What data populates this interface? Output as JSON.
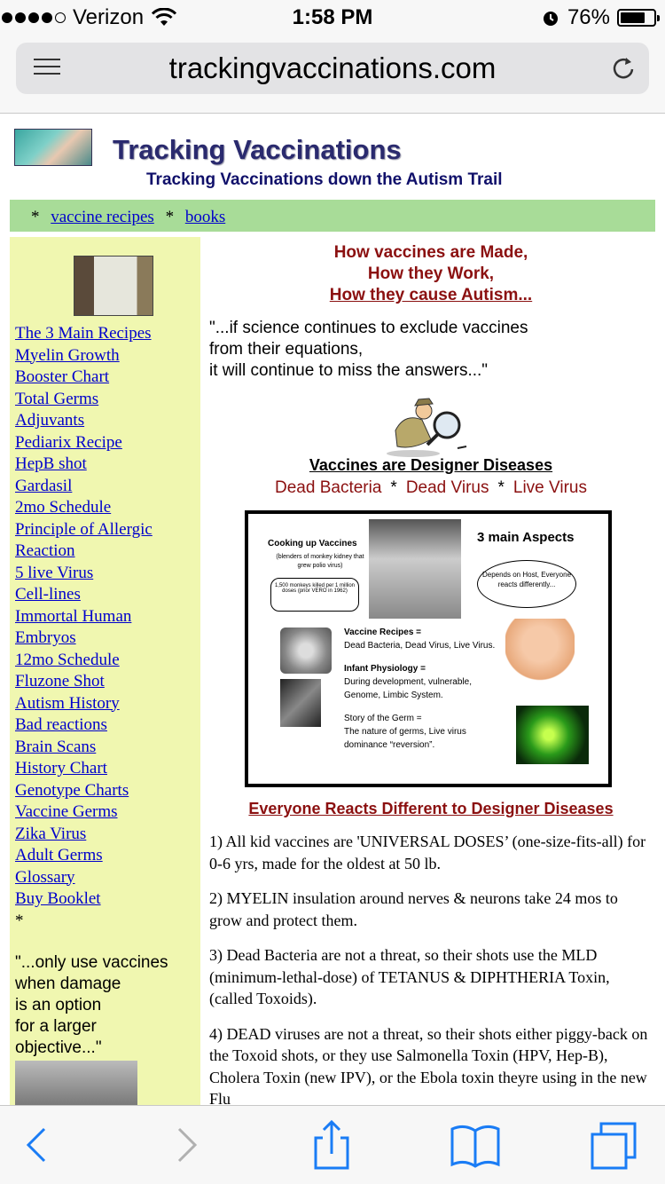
{
  "status_bar": {
    "carrier": "Verizon",
    "time": "1:58 PM",
    "battery": "76%",
    "battery_level": 0.76
  },
  "browser": {
    "url": "trackingvaccinations.com"
  },
  "header": {
    "title": "Tracking Vaccinations",
    "subtitle": "Tracking Vaccinations down the Autism Trail"
  },
  "topnav": {
    "star": "*",
    "items": [
      "vaccine recipes",
      "books"
    ]
  },
  "sidebar": {
    "links": [
      "The 3 Main Recipes",
      "Myelin Growth",
      "Booster Chart",
      "Total Germs",
      "Adjuvants",
      "Pediarix Recipe",
      "HepB shot",
      "Gardasil",
      "2mo Schedule",
      "Principle of Allergic",
      "Reaction",
      "5 live Virus",
      "Cell-lines",
      "Immortal Human",
      "Embryos",
      "12mo Schedule",
      "Fluzone Shot",
      "Autism History",
      "Bad reactions",
      "Brain Scans",
      "History Chart",
      "Genotype Charts",
      "Vaccine Germs",
      "Zika Virus",
      "Adult Germs",
      "Glossary",
      "Buy Booklet"
    ],
    "asterisk": "*",
    "quote_lines": [
      "\"...only use vaccines",
      "when damage",
      "is an option",
      "for a larger",
      "objective...\""
    ]
  },
  "main": {
    "headline": [
      "How vaccines are Made,",
      "How they Work,",
      "How they cause Autism..."
    ],
    "quote_lines": [
      "\"...if science continues to exclude vaccines",
      "from their equations,",
      "it will continue to miss the answers...\""
    ],
    "designer_title": "Vaccines are Designer Diseases",
    "types": [
      "Dead Bacteria",
      "Dead Virus",
      "Live Virus"
    ],
    "type_sep": "*",
    "infographic": {
      "cooking_title": "Cooking up Vaccines",
      "cooking_sub": "(blenders of monkey kidney that grew polio virus)",
      "monkeys_note": "1,500 monkeys killed per 1 million doses (prior VERO in 1962)",
      "aspects_title": "3 main Aspects",
      "host_bubble": "Depends on Host, Everyone reacts differently...",
      "bullets": [
        {
          "title": "Vaccine Recipes =",
          "body": "Dead Bacteria, Dead Virus, Live Virus."
        },
        {
          "title": "Infant Physiology =",
          "body": "During development, vulnerable, Genome, Limbic System."
        },
        {
          "title": "Story of the Germ =",
          "body": "The nature of germs, Live virus dominance “reversion”."
        }
      ]
    },
    "everyone_title": "Everyone Reacts Different to Designer Diseases",
    "points": [
      "1) All kid vaccines are 'UNIVERSAL DOSES’ (one-size-fits-all) for 0-6 yrs, made for the oldest at 50 lb.",
      "2) MYELIN insulation around nerves & neurons take 24 mos to grow and protect them.",
      "3) Dead Bacteria are not a threat, so their shots use the MLD (minimum-lethal-dose) of TETANUS & DIPHTHERIA Toxin, (called Toxoids).",
      "4) DEAD viruses are not a threat, so their shots either piggy-back on the Toxoid shots, or they use Salmonella Toxin (HPV, Hep-B), Cholera Toxin (new IPV), or the Ebola toxin theyre using in the new Flu"
    ]
  },
  "colors": {
    "nav_green": "#a8dc98",
    "sidebar_yellow": "#f0f7b0",
    "headline_red": "#8b1010",
    "link_blue": "#0000cc",
    "ios_blue": "#1a7cf5"
  }
}
